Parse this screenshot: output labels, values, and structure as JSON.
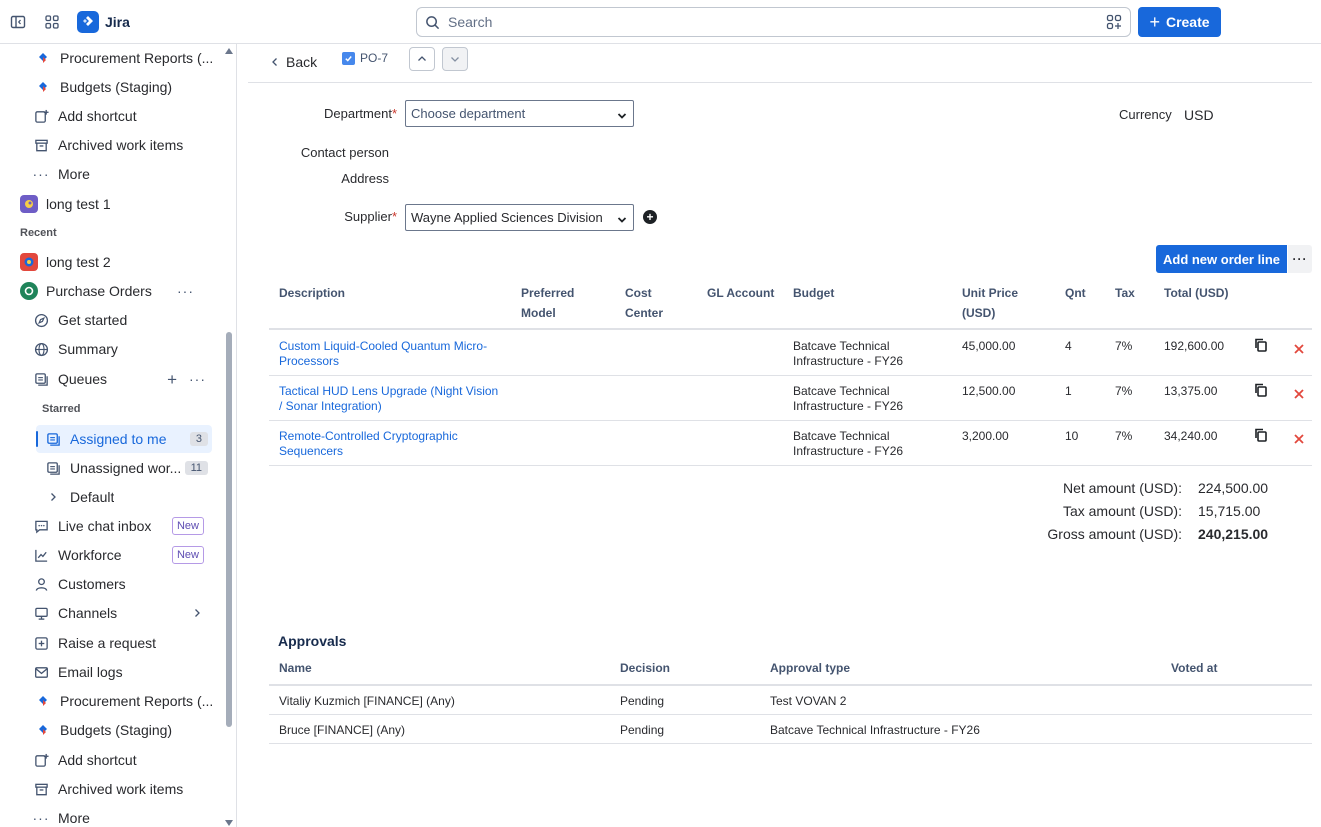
{
  "topbar": {
    "app_name": "Jira",
    "search_placeholder": "Search",
    "create_label": "Create"
  },
  "sidebar": {
    "items_top": [
      {
        "label": "Procurement Reports (..."
      },
      {
        "label": "Budgets (Staging)"
      },
      {
        "label": "Add shortcut"
      },
      {
        "label": "Archived work items"
      },
      {
        "label": "More"
      }
    ],
    "project_long1": "long test 1",
    "recent_heading": "Recent",
    "project_long2": "long test 2",
    "project_po": "Purchase Orders",
    "get_started": "Get started",
    "summary": "Summary",
    "queues": "Queues",
    "starred_heading": "Starred",
    "assigned_to_me": "Assigned to me",
    "assigned_count": "3",
    "unassigned": "Unassigned wor...",
    "unassigned_count": "11",
    "default": "Default",
    "live_chat": "Live chat inbox",
    "workforce": "Workforce",
    "new_badge": "New",
    "customers": "Customers",
    "channels": "Channels",
    "raise_request": "Raise a request",
    "email_logs": "Email logs",
    "items_bottom": [
      {
        "label": "Procurement Reports (..."
      },
      {
        "label": "Budgets (Staging)"
      },
      {
        "label": "Add shortcut"
      },
      {
        "label": "Archived work items"
      },
      {
        "label": "More"
      }
    ]
  },
  "main": {
    "back_label": "Back",
    "issue_key": "PO-7",
    "form": {
      "department_label": "Department",
      "department_value": "Choose department",
      "contact_label": "Contact person",
      "address_label": "Address",
      "supplier_label": "Supplier",
      "supplier_value": "Wayne Applied Sciences Division",
      "currency_label": "Currency",
      "currency_value": "USD"
    },
    "add_order_line": "Add new order line",
    "more_dots": "···",
    "columns": {
      "description": "Description",
      "preferred_1": "Preferred",
      "preferred_2": "Model",
      "cost_1": "Cost",
      "cost_2": "Center",
      "gl": "GL Account",
      "budget": "Budget",
      "unit_1": "Unit Price",
      "unit_2": "(USD)",
      "qnt": "Qnt",
      "tax": "Tax",
      "total": "Total (USD)"
    },
    "lines": [
      {
        "desc_1": "Custom Liquid-Cooled Quantum Micro-",
        "desc_2": "Processors",
        "budget_1": "Batcave Technical",
        "budget_2": "Infrastructure - FY26",
        "unit_price": "45,000.00",
        "qnt": "4",
        "tax": "7%",
        "total": "192,600.00"
      },
      {
        "desc_1": "Tactical HUD Lens Upgrade (Night Vision",
        "desc_2": "/ Sonar Integration)",
        "budget_1": "Batcave Technical",
        "budget_2": "Infrastructure - FY26",
        "unit_price": "12,500.00",
        "qnt": "1",
        "tax": "7%",
        "total": "13,375.00"
      },
      {
        "desc_1": "Remote-Controlled Cryptographic",
        "desc_2": "Sequencers",
        "budget_1": "Batcave Technical",
        "budget_2": "Infrastructure - FY26",
        "unit_price": "3,200.00",
        "qnt": "10",
        "tax": "7%",
        "total": "34,240.00"
      }
    ],
    "totals": {
      "net_label": "Net amount (USD):",
      "net_value": "224,500.00",
      "tax_label": "Tax amount (USD):",
      "tax_value": "15,715.00",
      "gross_label": "Gross amount (USD):",
      "gross_value": "240,215.00"
    },
    "approvals": {
      "title": "Approvals",
      "col_name": "Name",
      "col_decision": "Decision",
      "col_type": "Approval type",
      "col_voted": "Voted at",
      "rows": [
        {
          "name": "Vitaliy Kuzmich [FINANCE] (Any)",
          "decision": "Pending",
          "type": "Test VOVAN 2"
        },
        {
          "name": "Bruce [FINANCE] (Any)",
          "decision": "Pending",
          "type": "Batcave Technical Infrastructure - FY26"
        }
      ]
    }
  },
  "colors": {
    "brand": "#1868db",
    "delete": "#e2483d"
  }
}
